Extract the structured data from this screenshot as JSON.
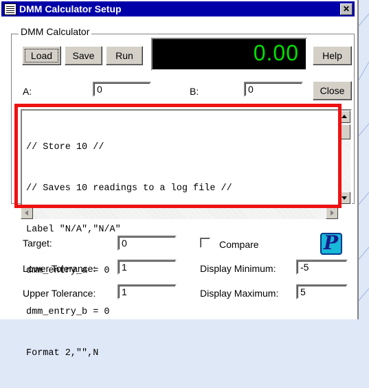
{
  "window": {
    "title": "DMM Calculator Setup",
    "close_glyph": "✕"
  },
  "group": {
    "legend": "DMM Calculator"
  },
  "toolbar": {
    "load_label": "Load",
    "save_label": "Save",
    "run_label": "Run",
    "help_label": "Help",
    "close_label": "Close"
  },
  "display": {
    "value": "0.00",
    "color": "#00e000"
  },
  "entries": {
    "a_label": "A:",
    "a_value": "0",
    "b_label": "B:",
    "b_value": "0"
  },
  "script": {
    "lines": [
      "// Store 10 //",
      "// Saves 10 readings to a log file //",
      "Label \"N/A\",\"N/A\"",
      "dmm_entry_a = 0",
      "dmm_entry_b = 0",
      "Format 2,\"\",N"
    ]
  },
  "settings": {
    "target_label": "Target:",
    "target_value": "0",
    "lower_label": "Lower Tolerance:",
    "lower_value": "1",
    "upper_label": "Upper Tolerance:",
    "upper_value": "1",
    "compare_label": "Compare",
    "compare_checked": false,
    "dmin_label": "Display Minimum:",
    "dmin_value": "-5",
    "dmax_label": "Display Maximum:",
    "dmax_value": "5"
  },
  "logo": {
    "glyph": "P",
    "icon": "p-logo-icon"
  },
  "colors": {
    "titlebar": "#0000a8",
    "highlight": "#ee1111",
    "logo_bg": "#18b8d8"
  }
}
